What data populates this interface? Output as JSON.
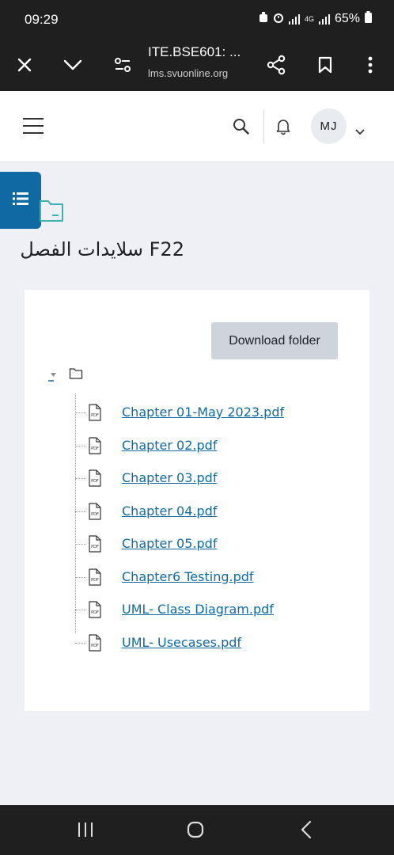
{
  "status_bar": {
    "time": "09:29",
    "network": "4G",
    "battery": "65%"
  },
  "browser": {
    "tab_title": "ITE.BSE601: ...",
    "host": "lms.svuonline.org"
  },
  "header": {
    "avatar_initials": "MJ"
  },
  "page": {
    "title": "F22 سلايدات الفصل"
  },
  "folder": {
    "download_label": "Download folder",
    "files": [
      "Chapter 01-May 2023.pdf",
      "Chapter 02.pdf",
      "Chapter 03.pdf",
      "Chapter 04.pdf",
      "Chapter 05.pdf",
      "Chapter6 Testing.pdf",
      "UML- Class Diagram.pdf",
      "UML- Usecases.pdf"
    ],
    "file_icon_label": "PDF"
  },
  "colors": {
    "accent": "#0f6aa3",
    "folder_icon": "#3ab2ae",
    "chrome": "#1f1f1f"
  },
  "icons": [
    "close-icon",
    "chevron-down-icon",
    "site-settings-icon",
    "share-icon",
    "bookmark-icon",
    "more-vert-icon",
    "menu-icon",
    "search-icon",
    "bell-icon",
    "list-icon",
    "folder-icon",
    "pdf-file-icon",
    "recent-apps-icon",
    "home-icon",
    "back-icon"
  ]
}
